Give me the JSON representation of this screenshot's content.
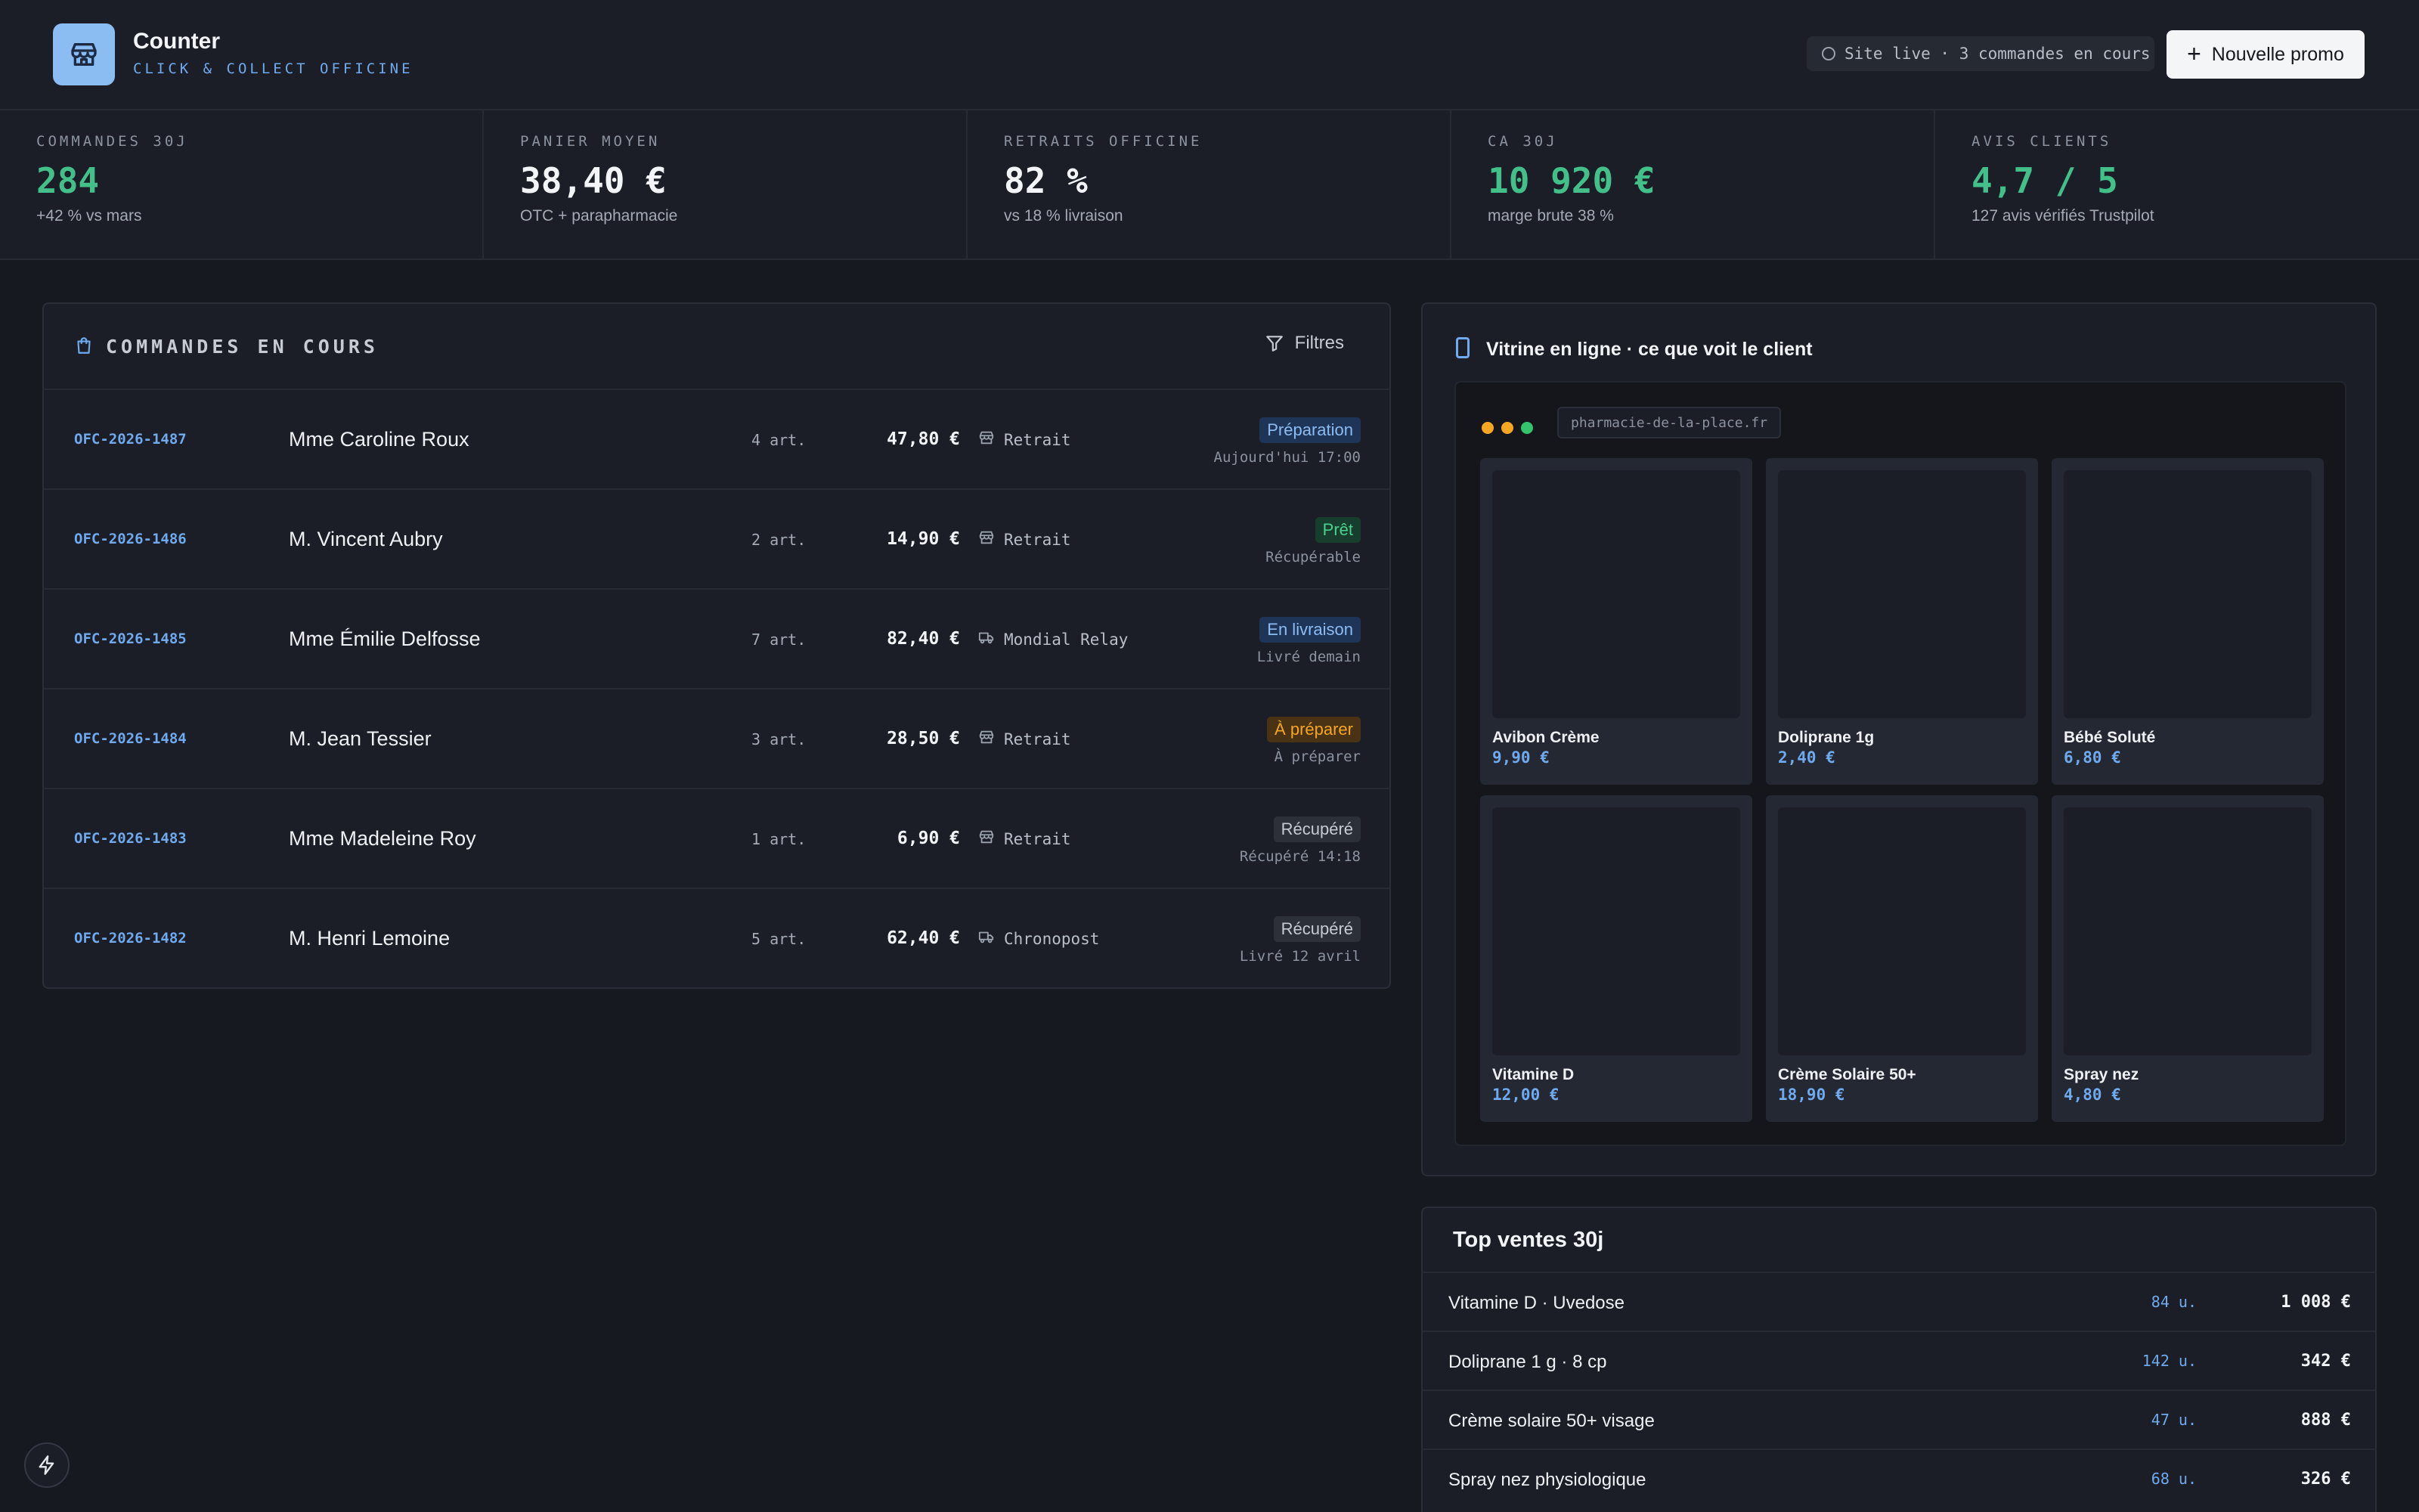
{
  "header": {
    "app_name": "Counter",
    "app_subtitle": "CLICK & COLLECT OFFICINE",
    "live_status": "Site live · 3 commandes en cours",
    "promo_button": "Nouvelle promo",
    "icons": {
      "logo": "store-icon",
      "live": "status-dot-icon",
      "promo": "plus-icon"
    }
  },
  "kpis": [
    {
      "label": "COMMANDES 30J",
      "value": "284",
      "note": "+42 % vs mars",
      "accent": true
    },
    {
      "label": "PANIER MOYEN",
      "value": "38,40 €",
      "note": "OTC + parapharmacie",
      "accent": false
    },
    {
      "label": "RETRAITS OFFICINE",
      "value": "82 %",
      "note": "vs 18 % livraison",
      "accent": false
    },
    {
      "label": "CA 30J",
      "value": "10 920 €",
      "note": "marge brute 38 %",
      "accent": true
    },
    {
      "label": "AVIS CLIENTS",
      "value": "4,7 / 5",
      "note": "127 avis vérifiés Trustpilot",
      "accent": true
    }
  ],
  "orders": {
    "title": "COMMANDES EN COURS",
    "filters_label": "Filtres",
    "rows": [
      {
        "id": "OFC-2026-1487",
        "name": "Mme Caroline Roux",
        "articles": "4 art.",
        "amount": "47,80 €",
        "mode": "Retrait",
        "mode_icon": "store-icon",
        "status": "Préparation",
        "status_kind": "prep",
        "sub": "Aujourd'hui 17:00"
      },
      {
        "id": "OFC-2026-1486",
        "name": "M. Vincent Aubry",
        "articles": "2 art.",
        "amount": "14,90 €",
        "mode": "Retrait",
        "mode_icon": "store-icon",
        "status": "Prêt",
        "status_kind": "pret",
        "sub": "Récupérable"
      },
      {
        "id": "OFC-2026-1485",
        "name": "Mme Émilie Delfosse",
        "articles": "7 art.",
        "amount": "82,40 €",
        "mode": "Mondial Relay",
        "mode_icon": "truck-icon",
        "status": "En livraison",
        "status_kind": "liv",
        "sub": "Livré demain"
      },
      {
        "id": "OFC-2026-1484",
        "name": "M. Jean Tessier",
        "articles": "3 art.",
        "amount": "28,50 €",
        "mode": "Retrait",
        "mode_icon": "store-icon",
        "status": "À préparer",
        "status_kind": "apr",
        "sub": "À préparer"
      },
      {
        "id": "OFC-2026-1483",
        "name": "Mme Madeleine Roy",
        "articles": "1 art.",
        "amount": "6,90 €",
        "mode": "Retrait",
        "mode_icon": "store-icon",
        "status": "Récupéré",
        "status_kind": "rec",
        "sub": "Récupéré 14:18"
      },
      {
        "id": "OFC-2026-1482",
        "name": "M. Henri Lemoine",
        "articles": "5 art.",
        "amount": "62,40 €",
        "mode": "Chronopost",
        "mode_icon": "truck-icon",
        "status": "Récupéré",
        "status_kind": "rec",
        "sub": "Livré 12 avril"
      }
    ]
  },
  "showcase": {
    "title": "Vitrine en ligne · ce que voit le client",
    "url": "pharmacie-de-la-place.fr",
    "products": [
      {
        "name": "Avibon Crème",
        "price": "9,90 €"
      },
      {
        "name": "Doliprane 1g",
        "price": "2,40 €"
      },
      {
        "name": "Bébé Soluté",
        "price": "6,80 €"
      },
      {
        "name": "Vitamine D",
        "price": "12,00 €"
      },
      {
        "name": "Crème Solaire 50+",
        "price": "18,90 €"
      },
      {
        "name": "Spray nez",
        "price": "4,80 €"
      }
    ]
  },
  "top_sales": {
    "title": "Top ventes 30j",
    "rows": [
      {
        "name": "Vitamine D · Uvedose",
        "qty": "84 u.",
        "amount": "1 008 €"
      },
      {
        "name": "Doliprane 1 g · 8 cp",
        "qty": "142 u.",
        "amount": "342 €"
      },
      {
        "name": "Crème solaire 50+ visage",
        "qty": "47 u.",
        "amount": "888 €"
      },
      {
        "name": "Spray nez physiologique",
        "qty": "68 u.",
        "amount": "326 €"
      }
    ]
  },
  "colors": {
    "accent_blue": "#6fa9ee",
    "accent_green": "#43c08a",
    "background": "#161920",
    "panel": "#1b1e26"
  }
}
